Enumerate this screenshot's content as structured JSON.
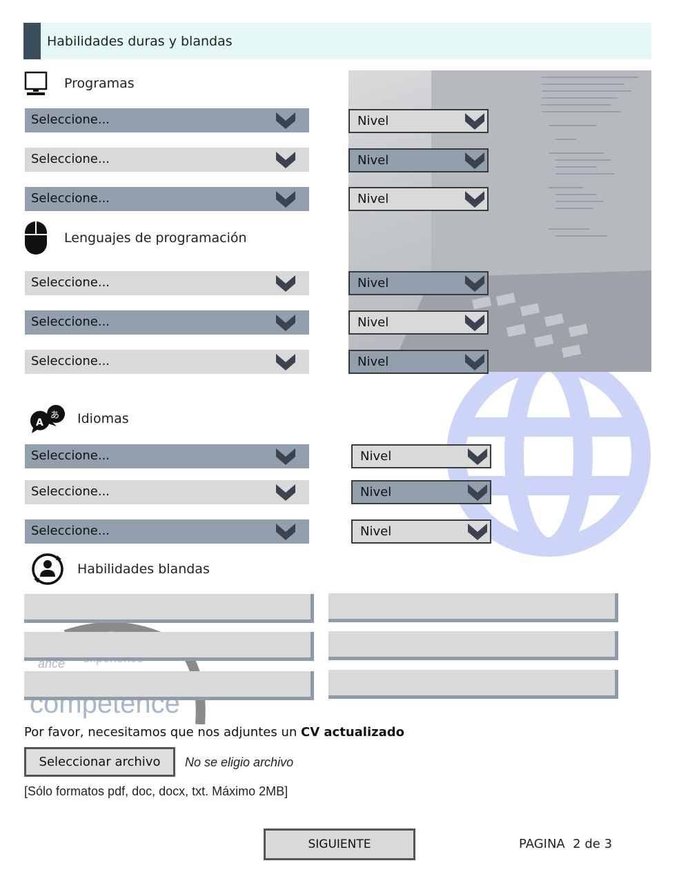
{
  "header": {
    "title": "Habilidades duras y blandas"
  },
  "sections": {
    "programs": "Programas",
    "languages_prog": "Lenguajes de programación",
    "idioms": "Idiomas",
    "soft": "Habilidades blandas"
  },
  "select_placeholder": "Seleccione...",
  "level_placeholder": "Nivel",
  "background_words": {
    "w1": "ance",
    "w2": "experience",
    "w3": "competence"
  },
  "upload": {
    "prompt_prefix": "Por favor, necesitamos que nos adjuntes un ",
    "prompt_bold": "CV actualizado",
    "button_label": "Seleccionar archivo",
    "no_file": "No se eligio archivo",
    "formats_note": "[Sólo formatos pdf, doc, docx, txt. Máximo 2MB]"
  },
  "footer": {
    "next_label": "SIGUIENTE",
    "page_indicator": "PAGINA  2 de 3"
  },
  "colors": {
    "select_dark": "#929fad",
    "select_light": "#d9d9d9",
    "header_bar": "#3b4e5e",
    "header_bg": "#e6f8f5",
    "globe": "#ccd5f7"
  }
}
